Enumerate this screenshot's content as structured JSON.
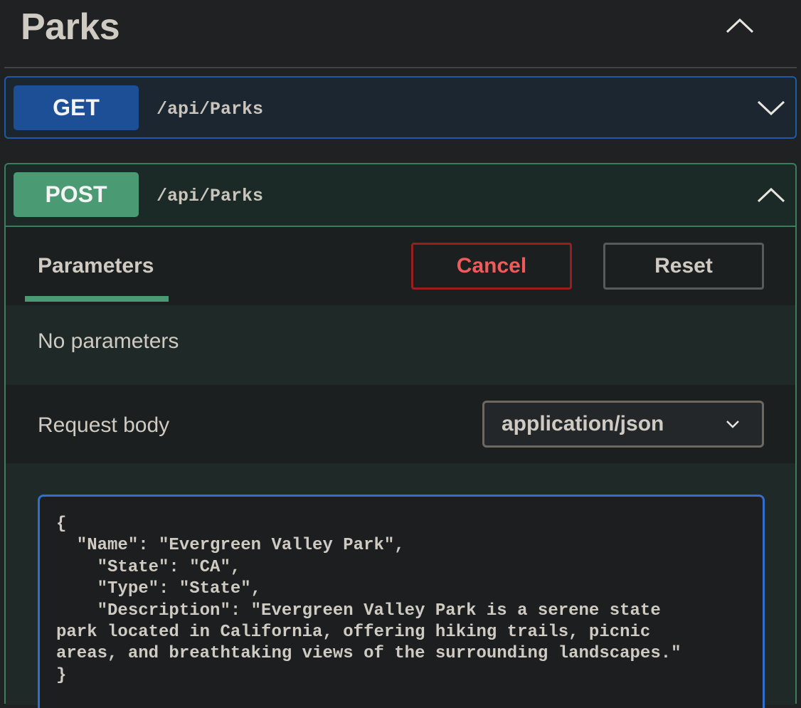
{
  "section": {
    "title": "Parks",
    "toggle_icon": "chevron-up-icon"
  },
  "operations": [
    {
      "method": "GET",
      "path": "/api/Parks",
      "color": "#1d4f96",
      "toggle_icon": "chevron-down-icon",
      "expanded": false
    },
    {
      "method": "POST",
      "path": "/api/Parks",
      "color": "#4a9a73",
      "toggle_icon": "chevron-up-icon",
      "expanded": true,
      "parameters_tab": "Parameters",
      "cancel_label": "Cancel",
      "reset_label": "Reset",
      "no_params_text": "No parameters",
      "request_body_label": "Request body",
      "content_type": "application/json",
      "body_text": "{\n  \"Name\": \"Evergreen Valley Park\",\n    \"State\": \"CA\",\n    \"Type\": \"State\",\n    \"Description\": \"Evergreen Valley Park is a serene state\npark located in California, offering hiking trails, picnic\nareas, and breathtaking views of the surrounding landscapes.\"\n}"
    }
  ],
  "colors": {
    "background": "#1f2122",
    "get_accent": "#1f5aa6",
    "post_accent": "#3d7c5d",
    "cancel_red": "#ef5b5b",
    "editor_focus": "#2f6fd0"
  }
}
